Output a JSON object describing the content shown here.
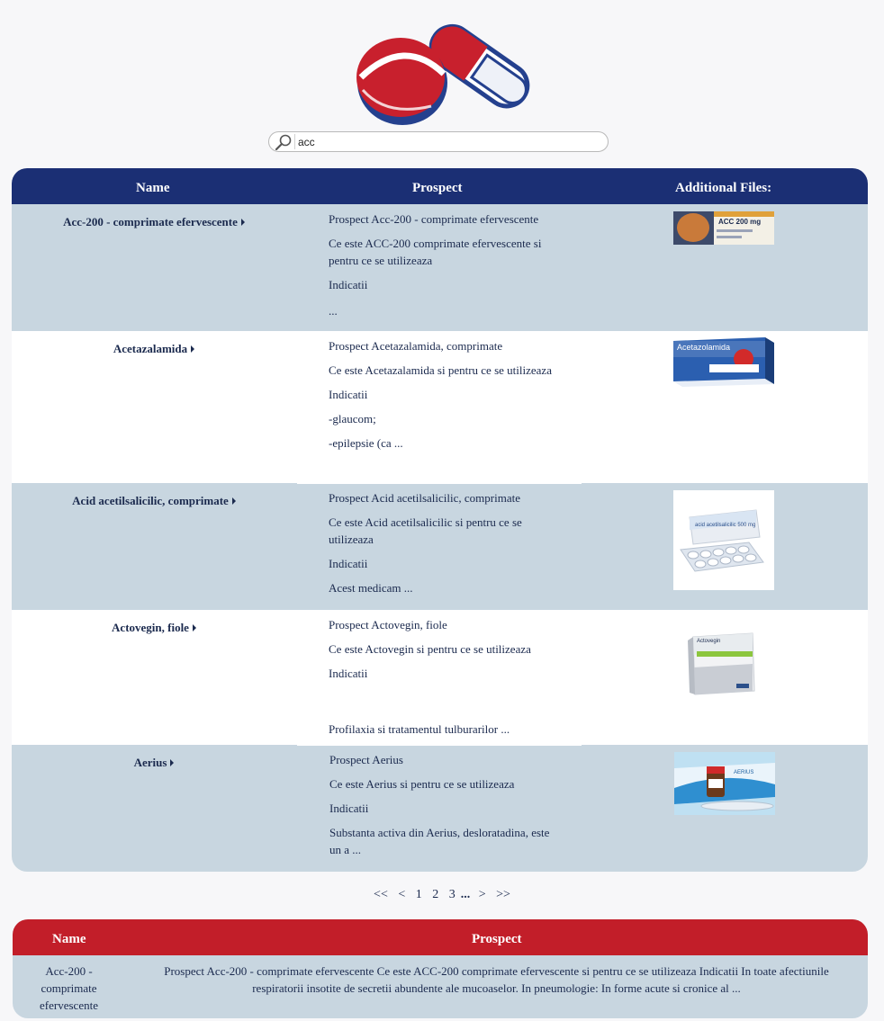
{
  "search": {
    "value": "acc"
  },
  "results_table": {
    "headers": {
      "name": "Name",
      "prospect": "Prospect",
      "files": "Additional Files:"
    },
    "rows": [
      {
        "name": "Acc-200 - comprimate efervescente",
        "prospect_title": "Prospect Acc-200 - comprimate efervescente",
        "lines": [
          "Ce este ACC-200 comprimate efervescente si pentru ce se utilizeaza",
          "Indicatii",
          " ..."
        ],
        "thumb_text": "ACC 200 mg"
      },
      {
        "name": "Acetazalamida",
        "prospect_title": "Prospect Acetazalamida, comprimate",
        "lines": [
          "Ce este Acetazalamida si pentru ce se utilizeaza",
          "Indicatii",
          "-glaucom;",
          "-epilepsie (ca ..."
        ],
        "thumb_text": "Acetazolamida"
      },
      {
        "name": "Acid acetilsalicilic, comprimate",
        "prospect_title": "Prospect Acid acetilsalicilic, comprimate",
        "lines": [
          "Ce este Acid acetilsalicilic si pentru ce se utilizeaza",
          "Indicatii",
          "Acest medicam ..."
        ],
        "thumb_text": "acid acetilsalicilic 500 mg"
      },
      {
        "name": "Actovegin, fiole",
        "prospect_title": "Prospect Actovegin, fiole",
        "lines": [
          "Ce este Actovegin si pentru ce se utilizeaza",
          "Indicatii",
          "",
          "Profilaxia si tratamentul tulburarilor ..."
        ],
        "thumb_text": "Actovegin"
      },
      {
        "name": "Aerius",
        "prospect_title": "Prospect Aerius",
        "lines": [
          "Ce este Aerius si pentru ce se utilizeaza",
          "Indicatii",
          "Substanta activa din Aerius, desloratadina, este un a ..."
        ],
        "thumb_text": "AERIUS"
      }
    ]
  },
  "pagination": {
    "first": "<<",
    "prev": "<",
    "pages": [
      "1",
      "2",
      "3"
    ],
    "dots": "...",
    "next": ">",
    "last": ">>"
  },
  "second_table": {
    "headers": {
      "name": "Name",
      "prospect": "Prospect"
    },
    "row": {
      "name": "Acc-200 - comprimate efervescente",
      "prospect": "Prospect Acc-200 - comprimate efervescente Ce este ACC-200 comprimate efervescente si pentru ce se utilizeaza Indicatii In toate afectiunile respiratorii insotite de secretii abundente ale mucoaselor. In pneumologie: In forme acute si cronice al ..."
    }
  },
  "colors": {
    "header_blue": "#1b2f74",
    "header_red": "#c21e29",
    "row_alt": "#c8d6e0",
    "text": "#1b2a4e"
  },
  "icons": {
    "logo": "pill-capsule-logo",
    "search": "magnifier-icon",
    "row_arrow": "caret-right-icon"
  }
}
